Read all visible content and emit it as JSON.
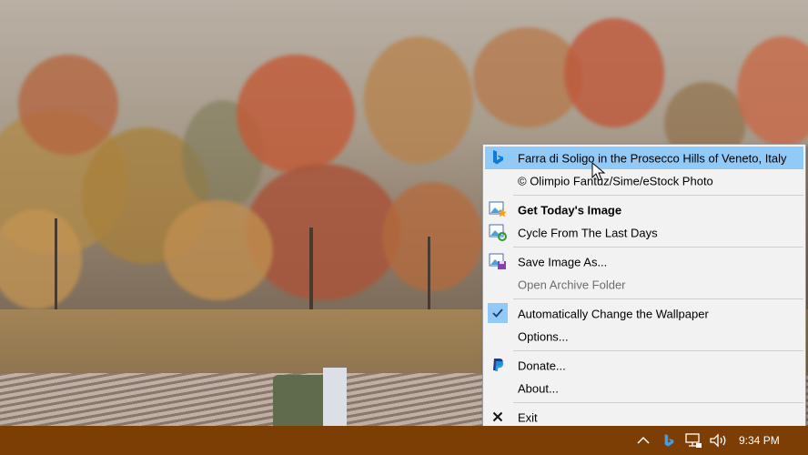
{
  "menu": {
    "title": "Farra di Soligo in the Prosecco Hills of Veneto, Italy",
    "copyright": "© Olimpio Fantuz/Sime/eStock Photo",
    "get_today": "Get Today's Image",
    "cycle": "Cycle From The Last Days",
    "save_as": "Save Image As...",
    "open_archive": "Open Archive Folder",
    "auto_change": "Automatically Change the Wallpaper",
    "options": "Options...",
    "donate": "Donate...",
    "about": "About...",
    "exit": "Exit"
  },
  "taskbar": {
    "time": "9:34 PM",
    "color": "#7d3e06"
  },
  "colors": {
    "highlight": "#91c9f7",
    "bing_blue": "#0c7bd6",
    "paypal_blue": "#1a67c8"
  }
}
